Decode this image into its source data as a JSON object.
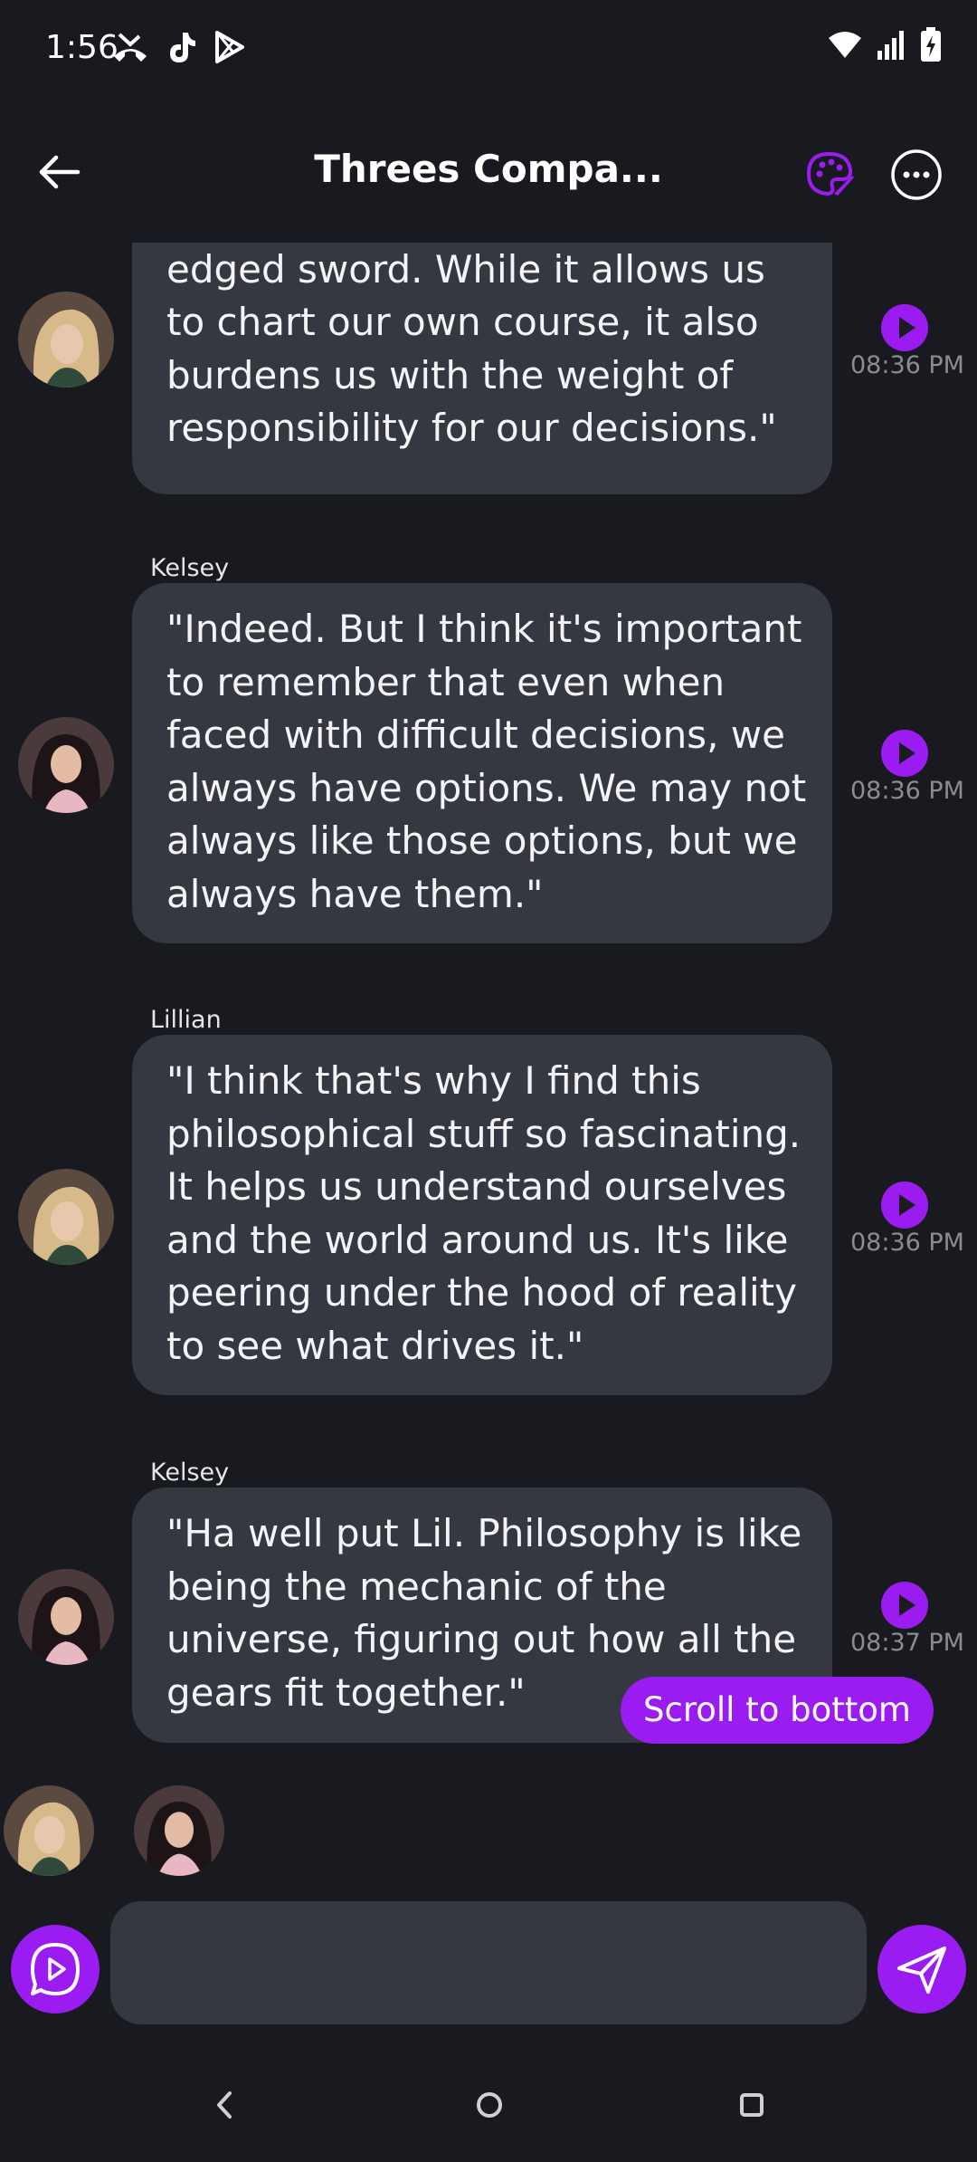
{
  "status_bar": {
    "time": "1:56",
    "left_icons": [
      "missed-call-icon",
      "tiktok-icon",
      "play-store-icon"
    ],
    "right_icons": [
      "wifi-icon",
      "signal-icon",
      "battery-charging-icon"
    ]
  },
  "header": {
    "title": "Threes Compa...",
    "back_icon": "arrow-left-icon",
    "palette_icon": "palette-icon",
    "more_icon": "more-horizontal-icon"
  },
  "messages": [
    {
      "sender": "",
      "avatar": "avatar-blonde",
      "text": "\"Free will is indeed a double-edged sword. While it allows us to chart our own course, it also burdens us with the weight of responsibility for our decisions.\"",
      "time": "08:36 PM"
    },
    {
      "sender": "Kelsey",
      "avatar": "avatar-brunette",
      "text": "\"Indeed. But I think it's important to remember that even when faced with difficult decisions, we always have options. We may not always like those options, but we always have them.\"",
      "time": "08:36 PM"
    },
    {
      "sender": "Lillian",
      "avatar": "avatar-blonde",
      "text": "\"I think that's why I find this philosophical stuff so fascinating. It helps us understand ourselves and the world around us. It's like peering under the hood of reality to see what drives it.\"",
      "time": "08:36 PM"
    },
    {
      "sender": "Kelsey",
      "avatar": "avatar-brunette",
      "text": "\"Ha well put Lil. Philosophy is like being the mechanic of the universe, figuring out how all the gears fit together.\"",
      "time": "08:37 PM"
    }
  ],
  "scroll_button": "Scroll to bottom",
  "composer": {
    "placeholder": "",
    "value": ""
  },
  "colors": {
    "accent": "#9b1cf0",
    "background": "#191a1f",
    "bubble": "#353840",
    "timestamp": "#8b8c93"
  }
}
